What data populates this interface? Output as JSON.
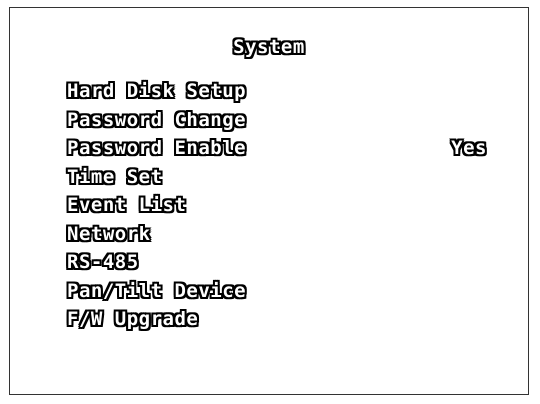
{
  "screen": {
    "title": "System",
    "menu": [
      {
        "label": "Hard Disk Setup",
        "value": ""
      },
      {
        "label": "Password Change",
        "value": ""
      },
      {
        "label": "Password Enable",
        "value": "Yes"
      },
      {
        "label": "Time Set",
        "value": ""
      },
      {
        "label": "Event List",
        "value": ""
      },
      {
        "label": "Network",
        "value": ""
      },
      {
        "label": "RS-485",
        "value": ""
      },
      {
        "label": "Pan/Tilt Device",
        "value": ""
      },
      {
        "label": "F/W Upgrade",
        "value": ""
      }
    ]
  },
  "colors": {
    "text_fill": "#ffffff",
    "text_outline": "#000000",
    "background": "#ffffff",
    "border": "#333333"
  }
}
